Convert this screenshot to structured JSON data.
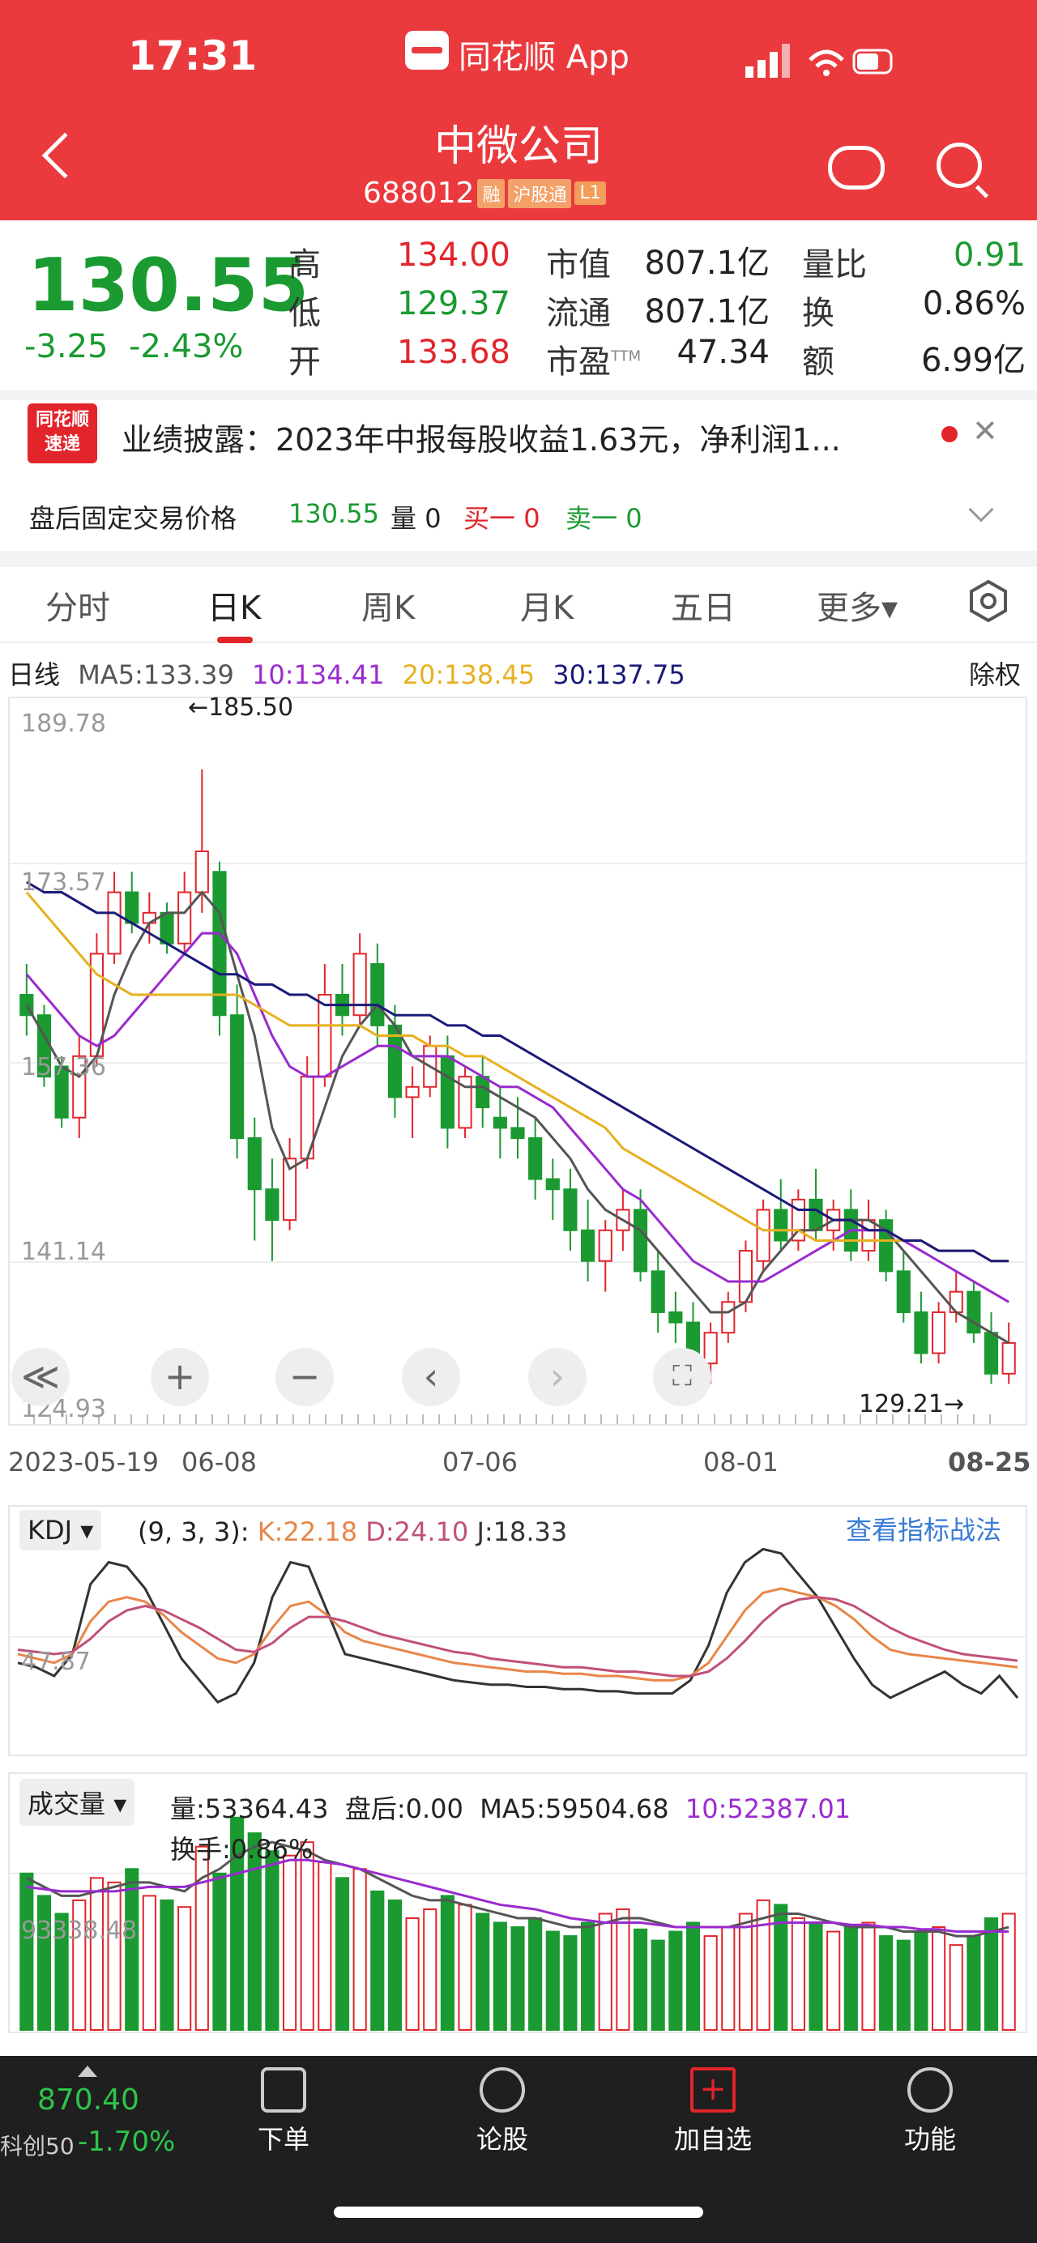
{
  "status": {
    "time": "17:31",
    "app_name": "同花顺 App"
  },
  "header": {
    "title": "中微公司",
    "code": "688012",
    "tags": [
      "融",
      "沪股通",
      "L1"
    ]
  },
  "quote": {
    "price": "130.55",
    "change": "-3.25",
    "change_pct": "-2.43%",
    "rows": [
      {
        "l1": "高",
        "v1": "134.00",
        "l2": "市值",
        "v2": "807.1亿",
        "l3": "量比",
        "v3": "0.91"
      },
      {
        "l1": "低",
        "v1": "129.37",
        "l2": "流通",
        "v2": "807.1亿",
        "l3": "换",
        "v3": "0.86%"
      },
      {
        "l1": "开",
        "v1": "133.68",
        "l2": "市盈",
        "v2": "47.34",
        "l3": "额",
        "v3": "6.99亿"
      }
    ],
    "pe_sup": "TTM"
  },
  "news": {
    "logo_line1": "同花顺",
    "logo_line2": "速递",
    "text": "业绩披露：2023年中报每股收益1.63元，净利润1..."
  },
  "after_hours": {
    "label": "盘后固定交易价格",
    "price": "130.55",
    "vol_label": "量",
    "vol": "0",
    "buy_label": "买一",
    "buy": "0",
    "sell_label": "卖一",
    "sell": "0"
  },
  "tabs": [
    "分时",
    "日K",
    "周K",
    "月K",
    "五日",
    "更多▾"
  ],
  "ma": {
    "period": "日线",
    "ma5": "MA5:133.39",
    "ma10": "10:134.41",
    "ma20": "20:138.45",
    "ma30": "30:137.75",
    "right": "除权"
  },
  "colors": {
    "up": "#e2252b",
    "down": "#1a9a31",
    "ma5": "#555555",
    "ma10": "#9a2bcf",
    "ma20": "#e8b020",
    "ma30": "#1a1a7a"
  },
  "chart_data": {
    "type": "candlestick",
    "y_ticks": [
      "189.78",
      "173.57",
      "157.36",
      "141.14",
      "124.93"
    ],
    "ylim": [
      124.93,
      189.78
    ],
    "high_label": "←185.50",
    "low_label": "129.21→",
    "dates": [
      "2023-05-19",
      "06-08",
      "07-06",
      "08-01",
      "08-25"
    ],
    "candles": [
      [
        164,
        167,
        160,
        162
      ],
      [
        162,
        163,
        155,
        156
      ],
      [
        157,
        158,
        151,
        152
      ],
      [
        152,
        160,
        150,
        158
      ],
      [
        158,
        170,
        157,
        168
      ],
      [
        168,
        176,
        167,
        174
      ],
      [
        174,
        176,
        170,
        171
      ],
      [
        171,
        174,
        169,
        172
      ],
      [
        172,
        173,
        168,
        169
      ],
      [
        169,
        176,
        168,
        174
      ],
      [
        174,
        186,
        172,
        178
      ],
      [
        176,
        177,
        160,
        162
      ],
      [
        162,
        165,
        148,
        150
      ],
      [
        150,
        152,
        140,
        145
      ],
      [
        145,
        148,
        138,
        142
      ],
      [
        142,
        150,
        141,
        148
      ],
      [
        148,
        158,
        147,
        156
      ],
      [
        156,
        167,
        155,
        164
      ],
      [
        164,
        167,
        160,
        162
      ],
      [
        162,
        170,
        161,
        168
      ],
      [
        167,
        169,
        159,
        161
      ],
      [
        161,
        163,
        152,
        154
      ],
      [
        154,
        157,
        150,
        155
      ],
      [
        155,
        160,
        154,
        159
      ],
      [
        158,
        160,
        149,
        151
      ],
      [
        151,
        157,
        150,
        156
      ],
      [
        156,
        158,
        151,
        153
      ],
      [
        152,
        155,
        148,
        151
      ],
      [
        151,
        154,
        148,
        150
      ],
      [
        150,
        152,
        144,
        146
      ],
      [
        146,
        148,
        142,
        145
      ],
      [
        145,
        147,
        139,
        141
      ],
      [
        141,
        144,
        136,
        138
      ],
      [
        138,
        142,
        135,
        141
      ],
      [
        141,
        145,
        139,
        143
      ],
      [
        143,
        145,
        136,
        137
      ],
      [
        137,
        139,
        131,
        133
      ],
      [
        133,
        135,
        130,
        132
      ],
      [
        132,
        134,
        127,
        128
      ],
      [
        128,
        132,
        126,
        131
      ],
      [
        131,
        135,
        130,
        134
      ],
      [
        134,
        140,
        133,
        139
      ],
      [
        138,
        144,
        137,
        143
      ],
      [
        143,
        146,
        139,
        140
      ],
      [
        140,
        145,
        139,
        144
      ],
      [
        144,
        147,
        140,
        141
      ],
      [
        141,
        144,
        139,
        143
      ],
      [
        143,
        145,
        138,
        139
      ],
      [
        139,
        144,
        138,
        142
      ],
      [
        142,
        143,
        136,
        137
      ],
      [
        137,
        139,
        132,
        133
      ],
      [
        133,
        135,
        128,
        129
      ],
      [
        129,
        134,
        128,
        133
      ],
      [
        133,
        137,
        132,
        135
      ],
      [
        135,
        136,
        130,
        131
      ],
      [
        131,
        133,
        126,
        127
      ],
      [
        127,
        132,
        126,
        130
      ]
    ],
    "ma5": [
      163,
      160,
      157,
      156,
      158,
      164,
      168,
      171,
      172,
      172,
      174,
      172,
      166,
      160,
      151,
      147,
      148,
      153,
      158,
      161,
      163,
      161,
      158,
      157,
      156,
      155,
      155,
      154,
      153,
      152,
      150,
      148,
      145,
      143,
      142,
      141,
      139,
      137,
      135,
      133,
      133,
      134,
      137,
      139,
      141,
      141,
      142,
      142,
      142,
      141,
      139,
      137,
      135,
      133,
      132,
      131,
      130
    ],
    "ma10": [
      166,
      164,
      162,
      160,
      159,
      160,
      162,
      164,
      166,
      168,
      170,
      170,
      168,
      164,
      160,
      157,
      156,
      156,
      157,
      158,
      159,
      159,
      158,
      158,
      158,
      157,
      156,
      155,
      155,
      154,
      153,
      151,
      149,
      147,
      145,
      144,
      142,
      140,
      138,
      137,
      136,
      136,
      136,
      137,
      138,
      139,
      140,
      141,
      141,
      141,
      140,
      139,
      138,
      137,
      136,
      135,
      134
    ],
    "ma20": [
      174,
      172,
      170,
      168,
      166,
      165,
      164,
      164,
      164,
      164,
      164,
      164,
      164,
      163,
      162,
      161,
      161,
      161,
      161,
      161,
      160,
      160,
      160,
      159,
      159,
      158,
      158,
      157,
      156,
      155,
      154,
      153,
      152,
      151,
      149,
      148,
      147,
      146,
      145,
      144,
      143,
      142,
      141,
      141,
      141,
      140,
      140,
      140,
      140,
      140,
      140,
      140,
      139,
      139,
      139,
      138,
      138
    ],
    "ma30": [
      175,
      174,
      174,
      173,
      172,
      172,
      171,
      170,
      169,
      168,
      167,
      166,
      166,
      165,
      165,
      164,
      164,
      163,
      163,
      163,
      163,
      162,
      162,
      162,
      161,
      161,
      160,
      160,
      159,
      158,
      157,
      156,
      155,
      154,
      153,
      152,
      151,
      150,
      149,
      148,
      147,
      146,
      145,
      144,
      143,
      143,
      142,
      142,
      141,
      141,
      140,
      140,
      139,
      139,
      139,
      138,
      138
    ]
  },
  "controls": {
    "collapse": "≪",
    "zoom_in": "+",
    "zoom_out": "−",
    "prev": "‹",
    "next": "›",
    "full": "⛶"
  },
  "kdj": {
    "name": "KDJ",
    "params": "(9, 3, 3):",
    "k": "K:22.18",
    "d": "D:24.10",
    "j": "J:18.33",
    "level": "47.87",
    "link": "查看指标战法",
    "k_series": [
      40,
      38,
      36,
      40,
      55,
      64,
      66,
      64,
      58,
      50,
      44,
      38,
      36,
      40,
      52,
      62,
      64,
      58,
      50,
      46,
      44,
      42,
      40,
      38,
      36,
      35,
      34,
      33,
      32,
      32,
      31,
      31,
      30,
      30,
      29,
      28,
      28,
      30,
      36,
      48,
      60,
      68,
      70,
      68,
      66,
      62,
      56,
      48,
      42,
      40,
      39,
      38,
      37,
      36,
      35,
      34
    ],
    "d_series": [
      42,
      41,
      40,
      41,
      47,
      55,
      60,
      62,
      60,
      56,
      52,
      47,
      42,
      41,
      45,
      52,
      57,
      57,
      55,
      52,
      49,
      47,
      45,
      43,
      41,
      40,
      38,
      37,
      36,
      35,
      34,
      34,
      33,
      32,
      32,
      31,
      30,
      30,
      32,
      38,
      46,
      55,
      62,
      65,
      66,
      65,
      62,
      57,
      52,
      48,
      45,
      42,
      40,
      39,
      38,
      37
    ],
    "j_series": [
      36,
      34,
      30,
      40,
      72,
      82,
      80,
      70,
      54,
      38,
      28,
      18,
      22,
      36,
      66,
      82,
      80,
      60,
      40,
      38,
      36,
      34,
      32,
      30,
      28,
      27,
      26,
      26,
      25,
      25,
      24,
      24,
      23,
      23,
      22,
      22,
      22,
      28,
      44,
      68,
      82,
      88,
      86,
      76,
      66,
      52,
      38,
      26,
      20,
      24,
      28,
      32,
      26,
      22,
      30,
      20
    ]
  },
  "volume": {
    "name": "成交量",
    "vol": "量:53364.43",
    "after": "盘后:0.00",
    "ma5": "MA5:59504.68",
    "ma10": "10:52387.01",
    "turnover": "换手:0.86%",
    "level": "93338.48",
    "bars": [
      70,
      60,
      52,
      58,
      68,
      66,
      72,
      60,
      58,
      55,
      82,
      70,
      95,
      88,
      80,
      78,
      84,
      75,
      68,
      72,
      62,
      58,
      50,
      54,
      60,
      56,
      52,
      48,
      46,
      50,
      44,
      42,
      48,
      52,
      54,
      45,
      40,
      44,
      48,
      42,
      46,
      52,
      58,
      56,
      50,
      48,
      44,
      46,
      48,
      42,
      40,
      44,
      46,
      38,
      42,
      50,
      52
    ],
    "ma5_series": [
      68,
      64,
      60,
      60,
      62,
      64,
      66,
      66,
      64,
      62,
      68,
      72,
      78,
      82,
      84,
      82,
      80,
      76,
      74,
      72,
      68,
      64,
      60,
      58,
      58,
      56,
      54,
      52,
      50,
      50,
      48,
      46,
      46,
      48,
      50,
      50,
      48,
      46,
      46,
      46,
      46,
      48,
      50,
      52,
      52,
      50,
      48,
      46,
      46,
      46,
      44,
      44,
      44,
      42,
      42,
      44,
      46
    ],
    "ma10_series": [
      64,
      63,
      62,
      62,
      62,
      62,
      63,
      64,
      64,
      64,
      66,
      68,
      70,
      72,
      74,
      76,
      76,
      75,
      74,
      72,
      70,
      68,
      66,
      64,
      62,
      60,
      58,
      56,
      55,
      54,
      52,
      50,
      49,
      48,
      48,
      48,
      47,
      46,
      46,
      46,
      46,
      46,
      47,
      48,
      48,
      48,
      48,
      47,
      47,
      46,
      46,
      45,
      45,
      44,
      44,
      44,
      44
    ]
  },
  "bottom": {
    "index_value": "870.40",
    "index_name": "科创50",
    "index_pct": "-1.70%",
    "nav": [
      "下单",
      "论股",
      "加自选",
      "功能"
    ]
  }
}
